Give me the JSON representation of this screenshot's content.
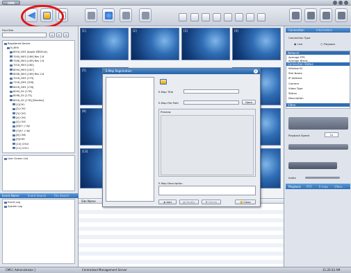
{
  "app": {
    "logo": "CMS"
  },
  "find": {
    "label": "Find Site"
  },
  "tree": {
    "root": "Registered Device",
    "items": [
      "N_BH4",
      "8016_DX3 [Apple 4ÅÄð¼ö]",
      "7004_MX3 [169] Rev 2.8",
      "7008_MX3 [169] Rev 2.8",
      "7016_MX3 [160]",
      "8004_MX3 [167]",
      "8008_MX3 [169] Rev 2.8",
      "7016_DX3 [179]",
      "7116_DX3 [158]",
      "8016_DX3 [178]",
      "8004_D1 [178]",
      "8008_D1 [173]",
      "8016_D1 [178] [Monitor]",
      "[1]CH1",
      "[2] CH2",
      "[3] CH3",
      "[4] CH4",
      "[5] CH5",
      "[6]0+ j¬ßÿ",
      "[7]A+ j¬ßÿ",
      "[8] CH8",
      "[9]CH9",
      "[10] CH10",
      "[11] CH11"
    ]
  },
  "user_screen": "User Screen List",
  "event_tabs": [
    "Event Name",
    "Event Search",
    "File Search"
  ],
  "logs": [
    "Event Log",
    "System Log"
  ],
  "channels": [
    "[1]",
    "[2]",
    "[3]",
    "[4]",
    "[5]",
    "[9]",
    "[13]"
  ],
  "event_table": {
    "site_name": "Site Name",
    "time": "Time",
    "memo": "Memo",
    "description": "Descrip"
  },
  "right_panel": {
    "tabs": [
      "Connection",
      "Information"
    ],
    "connection_type": "Connection Type",
    "live": "Live",
    "playback": "Playback",
    "sections": {
      "network": "Network",
      "status": "Connection Status",
      "video": "Video"
    },
    "network_rows": [
      "Average FPS",
      "Average Bitrat..."
    ],
    "status_rows": [
      "Window ID",
      "Site Name",
      "IP Address",
      "Camera",
      "Video Type",
      "Status",
      "Description"
    ],
    "playback_speed": "Playback Speed",
    "speed_value": "1x",
    "audio": "Audio",
    "bottom_tabs": [
      "Playback",
      "PTZ",
      "E-map",
      "Video..."
    ]
  },
  "modal": {
    "title": "E-Map Registration",
    "emap_title_label": "E-Map Title",
    "emap_path_label": "E-Map File Path",
    "preview_label": "Preview",
    "description_label": "E-Map Description",
    "open_button": "Open",
    "add_button": "Add",
    "modify_button": "Modify",
    "delete_button": "Delete",
    "close_button": "Close"
  },
  "status": {
    "user": "CMS [ Administrator ]",
    "server": "Centralized Management Server",
    "time": "11:20:33 AM"
  }
}
